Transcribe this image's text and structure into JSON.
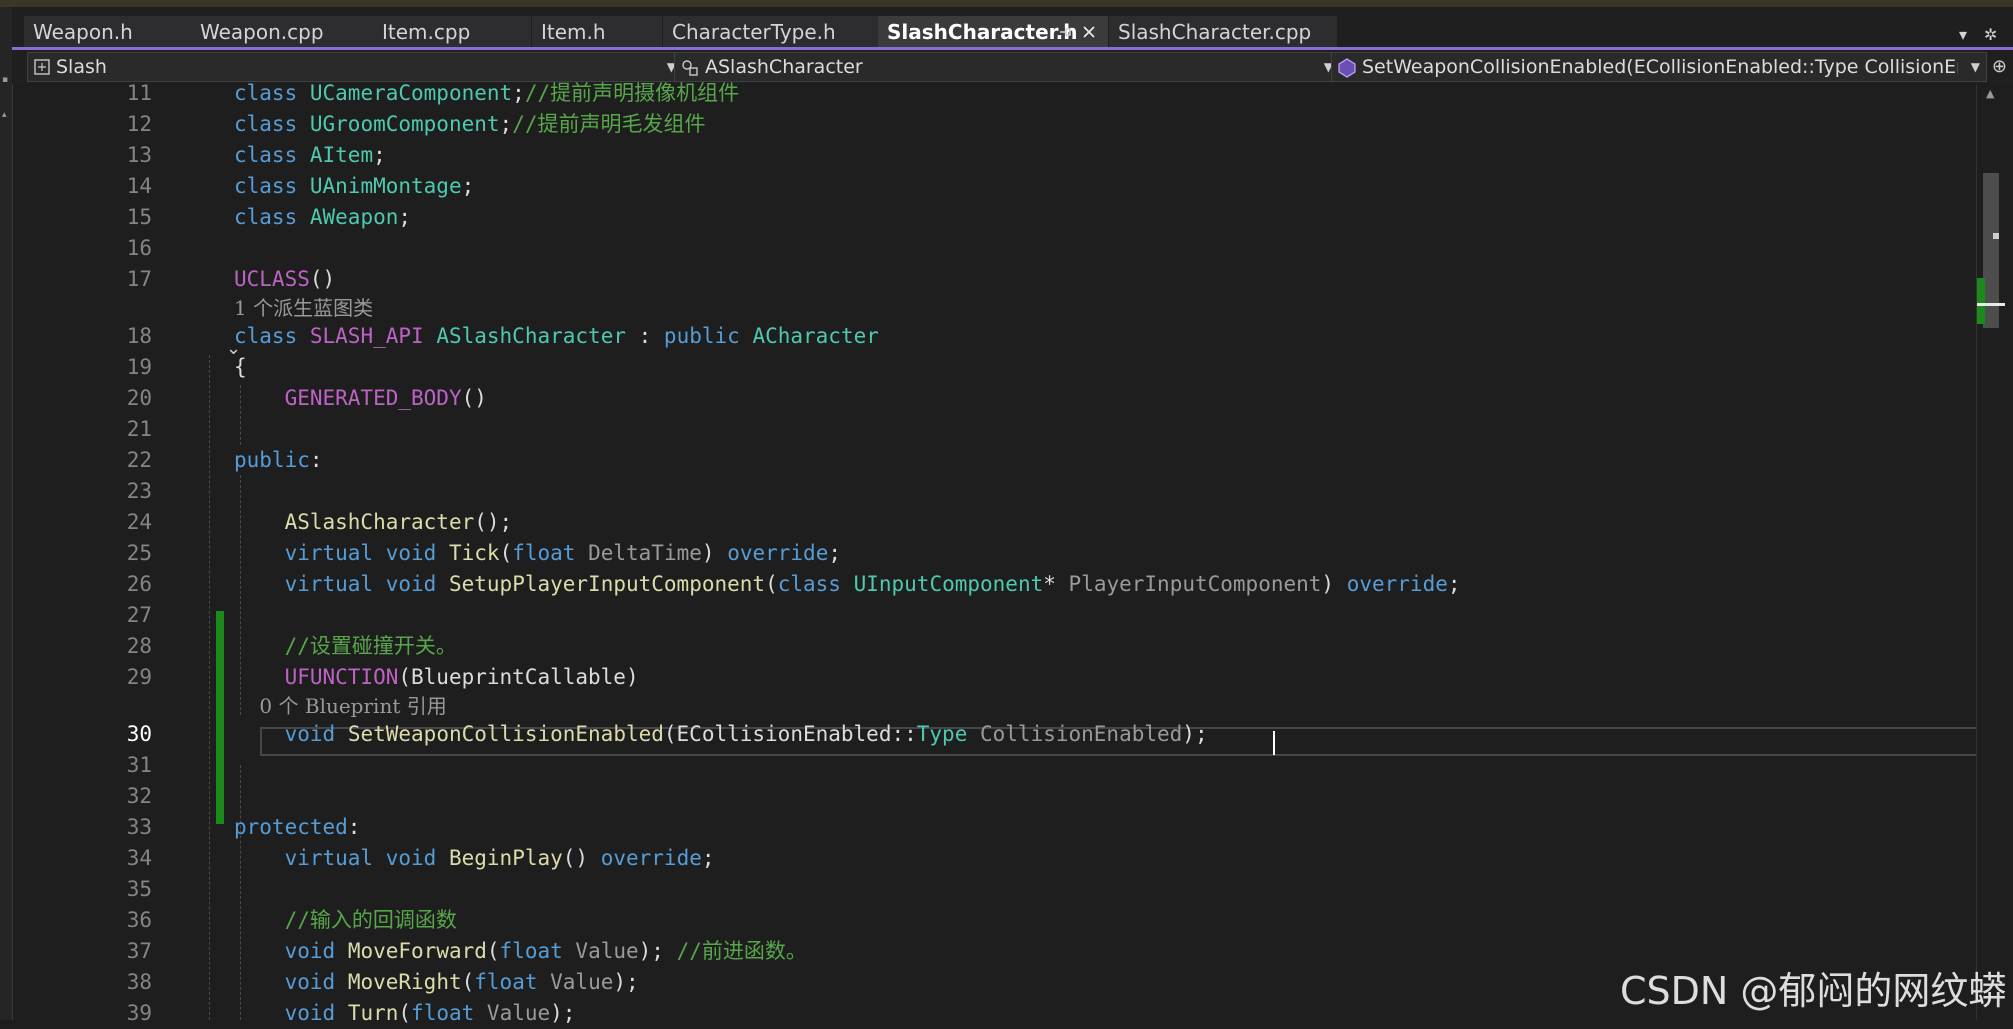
{
  "tabs": [
    {
      "label": "Weapon.h"
    },
    {
      "label": "Weapon.cpp"
    },
    {
      "label": "Item.cpp"
    },
    {
      "label": "Item.h"
    },
    {
      "label": "CharacterType.h"
    },
    {
      "label": "SlashCharacter.h",
      "active": true
    },
    {
      "label": "SlashCharacter.cpp"
    }
  ],
  "navbar": {
    "project": "Slash",
    "class": "ASlashCharacter",
    "member": "SetWeaponCollisionEnabled(ECollisionEnabled::Type CollisionEnablec"
  },
  "lines": [
    {
      "n": "11",
      "tokens": [
        [
          "k",
          "class"
        ],
        [
          "pl",
          " "
        ],
        [
          "t",
          "UCameraComponent"
        ],
        [
          "pl",
          ";"
        ],
        [
          "c",
          "//提前声明摄像机组件"
        ]
      ]
    },
    {
      "n": "12",
      "tokens": [
        [
          "k",
          "class"
        ],
        [
          "pl",
          " "
        ],
        [
          "t",
          "UGroomComponent"
        ],
        [
          "pl",
          ";"
        ],
        [
          "c",
          "//提前声明毛发组件"
        ]
      ]
    },
    {
      "n": "13",
      "tokens": [
        [
          "k",
          "class"
        ],
        [
          "pl",
          " "
        ],
        [
          "t",
          "AItem"
        ],
        [
          "pl",
          ";"
        ]
      ]
    },
    {
      "n": "14",
      "tokens": [
        [
          "k",
          "class"
        ],
        [
          "pl",
          " "
        ],
        [
          "t",
          "UAnimMontage"
        ],
        [
          "pl",
          ";"
        ]
      ]
    },
    {
      "n": "15",
      "tokens": [
        [
          "k",
          "class"
        ],
        [
          "pl",
          " "
        ],
        [
          "t",
          "AWeapon"
        ],
        [
          "pl",
          ";"
        ]
      ]
    },
    {
      "n": "16",
      "tokens": []
    },
    {
      "n": "17",
      "tokens": [
        [
          "m",
          "UCLASS"
        ],
        [
          "pl",
          "()"
        ]
      ]
    },
    {
      "lens": "1 个派生蓝图类"
    },
    {
      "n": "18",
      "tokens": [
        [
          "k",
          "class"
        ],
        [
          "pl",
          " "
        ],
        [
          "m",
          "SLASH_API"
        ],
        [
          "pl",
          " "
        ],
        [
          "t",
          "ASlashCharacter"
        ],
        [
          "pl",
          " : "
        ],
        [
          "k",
          "public"
        ],
        [
          "pl",
          " "
        ],
        [
          "t",
          "ACharacter"
        ]
      ]
    },
    {
      "n": "19",
      "tokens": [
        [
          "pl",
          "{"
        ]
      ]
    },
    {
      "n": "20",
      "tokens": [
        [
          "pl",
          "    "
        ],
        [
          "m",
          "GENERATED_BODY"
        ],
        [
          "pl",
          "()"
        ]
      ]
    },
    {
      "n": "21",
      "tokens": []
    },
    {
      "n": "22",
      "tokens": [
        [
          "k",
          "public"
        ],
        [
          "pl",
          ":"
        ]
      ]
    },
    {
      "n": "23",
      "tokens": []
    },
    {
      "n": "24",
      "tokens": [
        [
          "pl",
          "    "
        ],
        [
          "f",
          "ASlashCharacter"
        ],
        [
          "pl",
          "();"
        ]
      ]
    },
    {
      "n": "25",
      "tokens": [
        [
          "pl",
          "    "
        ],
        [
          "k",
          "virtual"
        ],
        [
          "pl",
          " "
        ],
        [
          "k",
          "void"
        ],
        [
          "pl",
          " "
        ],
        [
          "f",
          "Tick"
        ],
        [
          "pl",
          "("
        ],
        [
          "k",
          "float"
        ],
        [
          "pl",
          " "
        ],
        [
          "p",
          "DeltaTime"
        ],
        [
          "pl",
          ") "
        ],
        [
          "k",
          "override"
        ],
        [
          "pl",
          ";"
        ]
      ]
    },
    {
      "n": "26",
      "tokens": [
        [
          "pl",
          "    "
        ],
        [
          "k",
          "virtual"
        ],
        [
          "pl",
          " "
        ],
        [
          "k",
          "void"
        ],
        [
          "pl",
          " "
        ],
        [
          "f",
          "SetupPlayerInputComponent"
        ],
        [
          "pl",
          "("
        ],
        [
          "k",
          "class"
        ],
        [
          "pl",
          " "
        ],
        [
          "t",
          "UInputComponent"
        ],
        [
          "pl",
          "* "
        ],
        [
          "p",
          "PlayerInputComponent"
        ],
        [
          "pl",
          ") "
        ],
        [
          "k",
          "override"
        ],
        [
          "pl",
          ";"
        ]
      ]
    },
    {
      "n": "27",
      "tokens": []
    },
    {
      "n": "28",
      "tokens": [
        [
          "pl",
          "    "
        ],
        [
          "c",
          "//设置碰撞开关。"
        ]
      ]
    },
    {
      "n": "29",
      "tokens": [
        [
          "pl",
          "    "
        ],
        [
          "m",
          "UFUNCTION"
        ],
        [
          "pl",
          "(BlueprintCallable)"
        ]
      ]
    },
    {
      "lens": "    0 个 Blueprint 引用"
    },
    {
      "n": "30",
      "current": true,
      "tokens": [
        [
          "pl",
          "    "
        ],
        [
          "k",
          "void"
        ],
        [
          "pl",
          " "
        ],
        [
          "f",
          "SetWeaponCollisionEnabled"
        ],
        [
          "pl",
          "(ECollisionEnabled::"
        ],
        [
          "t",
          "Type"
        ],
        [
          "pl",
          " "
        ],
        [
          "p",
          "CollisionEnabled"
        ],
        [
          "pl",
          ");"
        ]
      ]
    },
    {
      "n": "31",
      "tokens": []
    },
    {
      "n": "32",
      "tokens": []
    },
    {
      "n": "33",
      "tokens": [
        [
          "k",
          "protected"
        ],
        [
          "pl",
          ":"
        ]
      ]
    },
    {
      "n": "34",
      "tokens": [
        [
          "pl",
          "    "
        ],
        [
          "k",
          "virtual"
        ],
        [
          "pl",
          " "
        ],
        [
          "k",
          "void"
        ],
        [
          "pl",
          " "
        ],
        [
          "f",
          "BeginPlay"
        ],
        [
          "pl",
          "() "
        ],
        [
          "k",
          "override"
        ],
        [
          "pl",
          ";"
        ]
      ]
    },
    {
      "n": "35",
      "tokens": []
    },
    {
      "n": "36",
      "tokens": [
        [
          "pl",
          "    "
        ],
        [
          "c",
          "//输入的回调函数"
        ]
      ]
    },
    {
      "n": "37",
      "tokens": [
        [
          "pl",
          "    "
        ],
        [
          "k",
          "void"
        ],
        [
          "pl",
          " "
        ],
        [
          "f",
          "MoveForward"
        ],
        [
          "pl",
          "("
        ],
        [
          "k",
          "float"
        ],
        [
          "pl",
          " "
        ],
        [
          "p",
          "Value"
        ],
        [
          "pl",
          "); "
        ],
        [
          "c",
          "//前进函数。"
        ]
      ]
    },
    {
      "n": "38",
      "tokens": [
        [
          "pl",
          "    "
        ],
        [
          "k",
          "void"
        ],
        [
          "pl",
          " "
        ],
        [
          "f",
          "MoveRight"
        ],
        [
          "pl",
          "("
        ],
        [
          "k",
          "float"
        ],
        [
          "pl",
          " "
        ],
        [
          "p",
          "Value"
        ],
        [
          "pl",
          ");"
        ]
      ]
    },
    {
      "n": "39",
      "tokens": [
        [
          "pl",
          "    "
        ],
        [
          "k",
          "void"
        ],
        [
          "pl",
          " "
        ],
        [
          "f",
          "Turn"
        ],
        [
          "pl",
          "("
        ],
        [
          "k",
          "float"
        ],
        [
          "pl",
          " "
        ],
        [
          "p",
          "Value"
        ],
        [
          "pl",
          ");"
        ]
      ]
    }
  ],
  "watermark": "CSDN @郁闷的网纹蟒",
  "colors": {
    "keyword": "#569cd6",
    "type": "#4ec9b0",
    "function": "#dcdcaa",
    "comment": "#57a64a",
    "macro": "#bd63c5",
    "param": "#9a9a9a",
    "accent": "#8a6fd1",
    "change_bar": "#1b8a1b"
  },
  "icons": {
    "project": "project-icon",
    "class": "class-icon",
    "member": "member-icon",
    "pin": "pin-icon",
    "close": "close-icon",
    "fold": "chevron-down-icon",
    "split": "split-editor-icon",
    "overflow": "dropdown-arrow-icon",
    "settings": "gear-icon"
  }
}
